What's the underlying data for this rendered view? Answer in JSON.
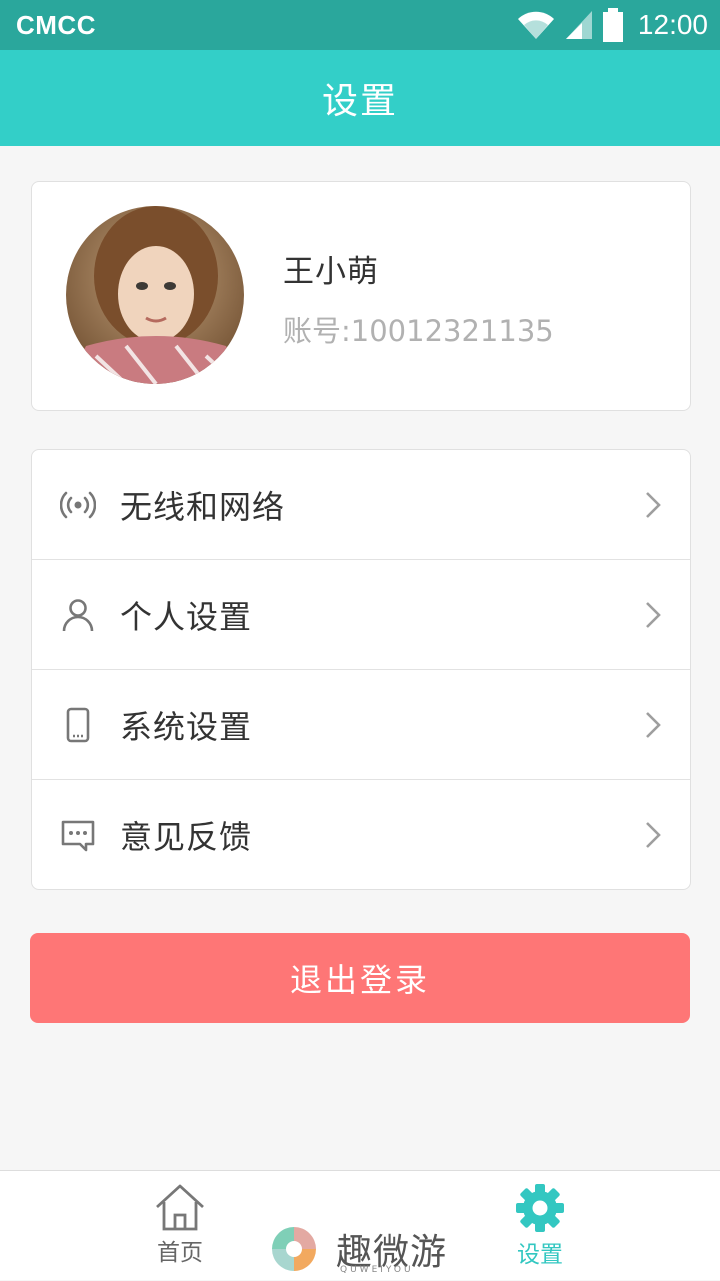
{
  "status_bar": {
    "carrier": "CMCC",
    "time": "12:00"
  },
  "header": {
    "title": "设置"
  },
  "profile": {
    "name": "王小萌",
    "account": "账号:10012321135"
  },
  "menu": {
    "items": [
      {
        "label": "无线和网络",
        "icon": "wireless-icon"
      },
      {
        "label": "个人设置",
        "icon": "person-icon"
      },
      {
        "label": "系统设置",
        "icon": "phone-icon"
      },
      {
        "label": "意见反馈",
        "icon": "chat-icon"
      }
    ]
  },
  "logout": {
    "label": "退出登录"
  },
  "tabbar": {
    "home_label": "首页",
    "settings_label": "设置",
    "brand_name": "趣微游",
    "brand_sub": "QUWEIYOU"
  },
  "colors": {
    "status_bar": "#2aa79c",
    "header": "#33cfc8",
    "logout": "#fe7676",
    "active_tab": "#33c7c1"
  }
}
